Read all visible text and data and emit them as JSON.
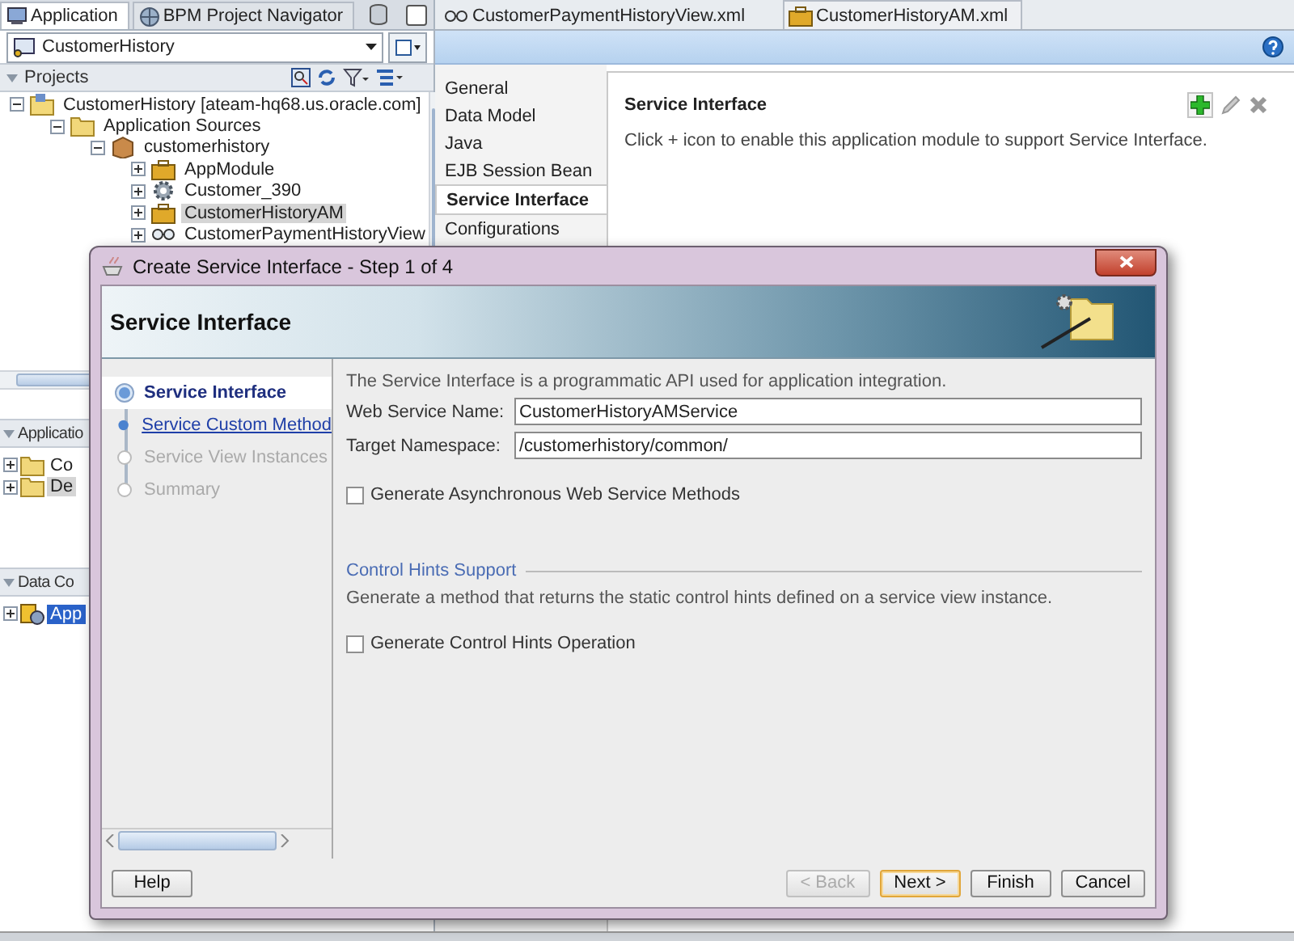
{
  "navigator": {
    "tabs": [
      {
        "label": "Application",
        "selected": true
      },
      {
        "label": "BPM Project Navigator",
        "selected": false
      }
    ],
    "application_selector": {
      "value": "CustomerHistory"
    },
    "projects": {
      "title": "Projects",
      "tree": [
        {
          "label": "CustomerHistory [ateam-hq68.us.oracle.com]",
          "kind": "project",
          "expanded": true,
          "selected": false,
          "children": [
            {
              "label": "Application Sources",
              "kind": "folder",
              "expanded": true,
              "selected": false,
              "children": [
                {
                  "label": "customerhistory",
                  "kind": "package",
                  "expanded": true,
                  "selected": false,
                  "children": [
                    {
                      "label": "AppModule",
                      "kind": "module",
                      "expanded": false,
                      "selected": false
                    },
                    {
                      "label": "Customer_390",
                      "kind": "entity",
                      "expanded": false,
                      "selected": false
                    },
                    {
                      "label": "CustomerHistoryAM",
                      "kind": "module",
                      "expanded": false,
                      "selected": true
                    },
                    {
                      "label": "CustomerPaymentHistoryView",
                      "kind": "view",
                      "expanded": false,
                      "selected": false
                    }
                  ]
                }
              ]
            }
          ]
        }
      ]
    },
    "resources": {
      "title": "Applicatio",
      "items": [
        {
          "label": "Co",
          "selected": false
        },
        {
          "label": "De",
          "selected": true
        }
      ]
    },
    "data_controls": {
      "title": "Data Co",
      "items": [
        {
          "label": "App",
          "selected": true
        }
      ]
    }
  },
  "editor": {
    "tabs": [
      {
        "label": "CustomerPaymentHistoryView.xml",
        "kind": "view",
        "selected": false
      },
      {
        "label": "CustomerHistoryAM.xml",
        "kind": "module",
        "selected": true
      }
    ],
    "nav": [
      {
        "label": "General",
        "selected": false
      },
      {
        "label": "Data Model",
        "selected": false
      },
      {
        "label": "Java",
        "selected": false
      },
      {
        "label": "EJB Session Bean",
        "selected": false
      },
      {
        "label": "Service Interface",
        "selected": true
      },
      {
        "label": "Configurations",
        "selected": false
      }
    ],
    "section_title": "Service Interface",
    "description": "Click + icon to enable this application module to support Service Interface."
  },
  "dialog": {
    "title": "Create Service Interface - Step 1 of 4",
    "banner_title": "Service Interface",
    "steps": [
      {
        "label": "Service Interface",
        "selected": true,
        "disabled": false
      },
      {
        "label": "Service Custom Method",
        "selected": false,
        "disabled": false
      },
      {
        "label": "Service View Instances",
        "selected": false,
        "disabled": true
      },
      {
        "label": "Summary",
        "selected": false,
        "disabled": true
      }
    ],
    "intro": "The Service Interface is a programmatic API used for application integration.",
    "fields": [
      {
        "label": "Web Service Name:",
        "value": "CustomerHistoryAMService"
      },
      {
        "label": "Target Namespace:",
        "value": "/customerhistory/common/"
      }
    ],
    "async_checkbox": {
      "label": "Generate Asynchronous Web Service Methods",
      "checked": false
    },
    "hints_section": {
      "title": "Control Hints Support",
      "description": "Generate a method that returns the static control hints defined on a service view instance.",
      "checkbox": {
        "label": "Generate Control Hints Operation",
        "checked": false
      }
    },
    "help_button": "Help",
    "buttons": [
      {
        "label": "< Back",
        "disabled": true,
        "default": false
      },
      {
        "label": "Next >",
        "disabled": false,
        "default": true
      },
      {
        "label": "Finish",
        "disabled": false,
        "default": false
      },
      {
        "label": "Cancel",
        "disabled": false,
        "default": false
      }
    ]
  }
}
